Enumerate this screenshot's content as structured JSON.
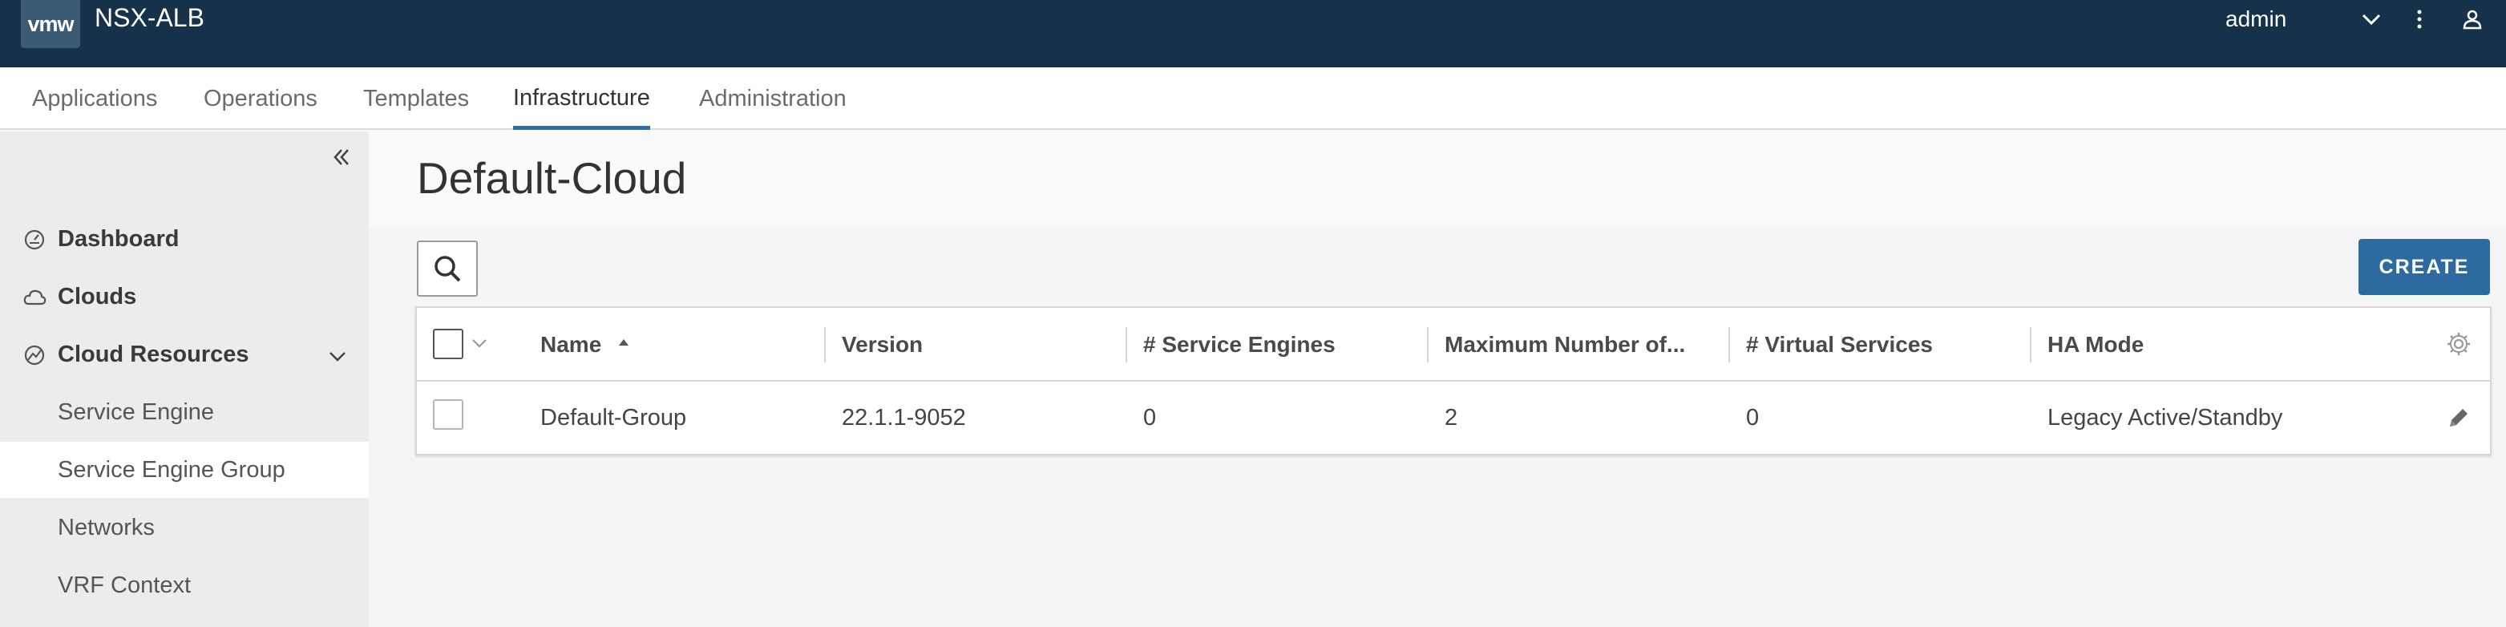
{
  "header": {
    "logo_text": "vmw",
    "app_title": "NSX-ALB",
    "user": "admin",
    "icons": [
      "chevron-down-icon",
      "more-vertical-icon",
      "user-icon"
    ]
  },
  "topnav": {
    "tabs": [
      {
        "label": "Applications"
      },
      {
        "label": "Operations"
      },
      {
        "label": "Templates"
      },
      {
        "label": "Infrastructure"
      },
      {
        "label": "Administration"
      }
    ],
    "active": "Infrastructure"
  },
  "sidebar": {
    "items": [
      {
        "label": "Dashboard",
        "icon": "dashboard-icon"
      },
      {
        "label": "Clouds",
        "icon": "cloud-icon"
      },
      {
        "label": "Cloud Resources",
        "icon": "cloud-resources-icon",
        "expanded": true
      },
      {
        "label": "Service Engine"
      },
      {
        "label": "Service Engine Group",
        "selected": true
      },
      {
        "label": "Networks"
      },
      {
        "label": "VRF Context"
      }
    ]
  },
  "main": {
    "title": "Default-Cloud",
    "create_label": "CREATE"
  },
  "grid": {
    "columns": [
      {
        "label": "Name",
        "sort": "ascending"
      },
      {
        "label": "Version"
      },
      {
        "label": "# Service Engines"
      },
      {
        "label": "Maximum Number of..."
      },
      {
        "label": "# Virtual Services"
      },
      {
        "label": "HA Mode"
      }
    ],
    "rows": [
      {
        "name": "Default-Group",
        "version": "22.1.1-9052",
        "service_engines": "0",
        "max_number": "2",
        "virtual_services": "0",
        "ha_mode": "Legacy Active/Standby"
      }
    ]
  },
  "colors": {
    "header_bg": "#16324a",
    "accent": "#2d6aa0",
    "sidebar_bg": "#ececec"
  }
}
